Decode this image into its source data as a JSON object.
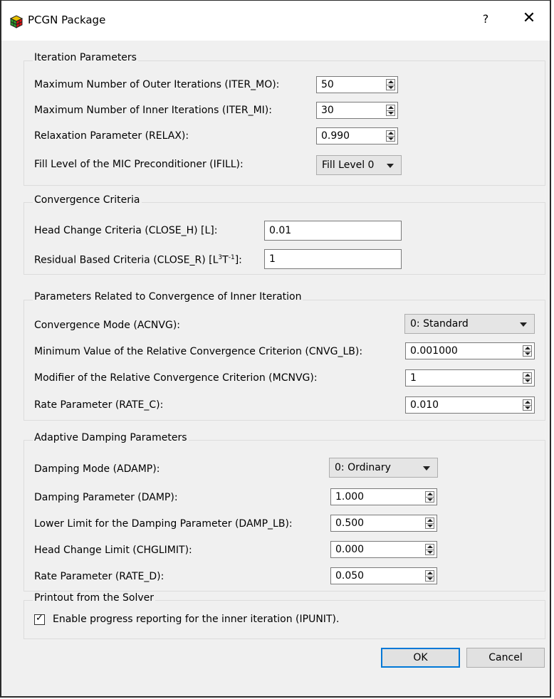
{
  "window": {
    "title": "PCGN Package",
    "help_label": "?",
    "close_label": "✕"
  },
  "iteration": {
    "title": "Iteration Parameters",
    "outer_label": "Maximum Number of Outer Iterations (ITER_MO):",
    "outer_value": "50",
    "inner_label": "Maximum Number of Inner Iterations (ITER_MI):",
    "inner_value": "30",
    "relax_label": "Relaxation Parameter (RELAX):",
    "relax_value": "0.990",
    "ifill_label": "Fill Level of the MIC Preconditioner (IFILL):",
    "ifill_value": "Fill Level 0"
  },
  "convergence": {
    "title": "Convergence Criteria",
    "closeh_label": "Head Change Criteria (CLOSE_H) [L]:",
    "closeh_value": "0.01",
    "closer_label_prefix": "Residual Based Criteria (CLOSE_R) [L",
    "closer_sup1": "3",
    "closer_mid": "T",
    "closer_sup2": "-1",
    "closer_suffix": "]:",
    "closer_value": "1"
  },
  "inner": {
    "title": "Parameters Related to Convergence of Inner Iteration",
    "acnvg_label": "Convergence Mode (ACNVG):",
    "acnvg_value": "0: Standard",
    "cnvglb_label": "Minimum Value of the Relative Convergence Criterion (CNVG_LB):",
    "cnvglb_value": "0.001000",
    "mcnvg_label": "Modifier of the Relative Convergence Criterion (MCNVG):",
    "mcnvg_value": "1",
    "ratec_label": "Rate Parameter (RATE_C):",
    "ratec_value": "0.010"
  },
  "damping": {
    "title": "Adaptive Damping Parameters",
    "adamp_label": "Damping Mode (ADAMP):",
    "adamp_value": "0: Ordinary",
    "damp_label": "Damping Parameter (DAMP):",
    "damp_value": "1.000",
    "damplb_label": "Lower Limit for the Damping Parameter (DAMP_LB):",
    "damplb_value": "0.500",
    "chglimit_label": "Head Change Limit (CHGLIMIT):",
    "chglimit_value": "0.000",
    "rated_label": "Rate Parameter (RATE_D):",
    "rated_value": "0.050"
  },
  "printout": {
    "title": "Printout from the Solver",
    "ipunit_label": "Enable progress reporting for the inner iteration (IPUNIT).",
    "ipunit_checked": true
  },
  "buttons": {
    "ok": "OK",
    "cancel": "Cancel"
  }
}
